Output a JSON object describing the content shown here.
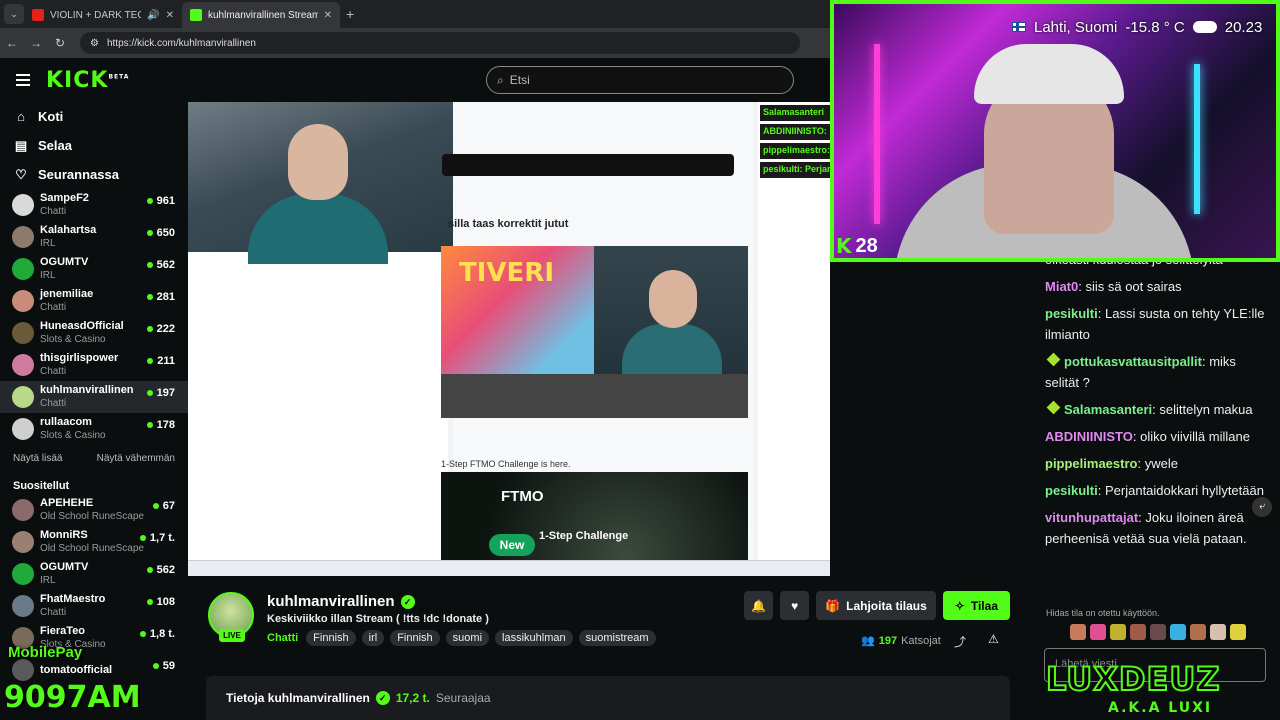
{
  "browser": {
    "tabs": [
      {
        "title": "VIOLIN + DARK TECHNO /",
        "active": false
      },
      {
        "title": "kuhlmanvirallinen Stream - Wa",
        "active": true
      }
    ],
    "url": "https://kick.com/kuhlmanvirallinen"
  },
  "header": {
    "logo": "KICK",
    "logo_badge": "BETA",
    "search_placeholder": "Etsi"
  },
  "nav": [
    {
      "label": "Koti",
      "icon": "home-icon"
    },
    {
      "label": "Selaa",
      "icon": "browse-icon"
    },
    {
      "label": "Seurannassa",
      "icon": "heart-icon"
    }
  ],
  "followed": [
    {
      "name": "SampeF2",
      "category": "Chatti",
      "viewers": "961",
      "color": "#d9d9d9"
    },
    {
      "name": "Kalahartsa",
      "category": "IRL",
      "viewers": "650",
      "color": "#8c7b6a"
    },
    {
      "name": "OGUMTV",
      "category": "IRL",
      "viewers": "562",
      "color": "#1faa3a"
    },
    {
      "name": "jenemiliae",
      "category": "Chatti",
      "viewers": "281",
      "color": "#c98c7a"
    },
    {
      "name": "HuneasdOfficial",
      "category": "Slots & Casino",
      "viewers": "222",
      "color": "#6a5a3a"
    },
    {
      "name": "thisgirlispower",
      "category": "Chatti",
      "viewers": "211",
      "color": "#d07aa0"
    },
    {
      "name": "kuhlmanvirallinen",
      "category": "Chatti",
      "viewers": "197",
      "color": "#b8d88a"
    },
    {
      "name": "rullaacom",
      "category": "Slots & Casino",
      "viewers": "178",
      "color": "#cfcfcf"
    }
  ],
  "show_more": "Näytä lisää",
  "show_less": "Näytä vähemmän",
  "recommended_title": "Suositellut",
  "recommended": [
    {
      "name": "APEHEHE",
      "category": "Old School RuneScape",
      "viewers": "67",
      "color": "#8a6a6a"
    },
    {
      "name": "MonniRS",
      "category": "Old School RuneScape",
      "viewers": "1,7 t.",
      "color": "#9a8070"
    },
    {
      "name": "OGUMTV",
      "category": "IRL",
      "viewers": "562",
      "color": "#1faa3a"
    },
    {
      "name": "FhatMaestro",
      "category": "Chatti",
      "viewers": "108",
      "color": "#6a7a8a"
    },
    {
      "name": "FieraTeo",
      "category": "Slots & Casino",
      "viewers": "1,8 t.",
      "color": "#7a6a5a"
    },
    {
      "name": "tomatoofficial",
      "category": "",
      "viewers": "59",
      "color": "#5a5a5a"
    }
  ],
  "player": {
    "inner_title": "silla taas korrektit jutut",
    "inner_thumb_text": "TIVERI",
    "ad_brand": "FTMO",
    "ad_badge": "New",
    "ad_text": "1-Step Challenge",
    "ad_caption": "1-Step FTMO Challenge is here.",
    "inner_chat": [
      "Salamasanteri",
      "ABDINIINISTO:",
      "pippelimaestro:",
      "pesikulti: Perjan"
    ]
  },
  "channel": {
    "name": "kuhlmanvirallinen",
    "live_label": "LIVE",
    "title": "Keskiviikko illan Stream ( !tts !dc !donate )",
    "category": "Chatti",
    "tags": [
      "Finnish",
      "irl",
      "Finnish",
      "suomi",
      "lassikuhlman",
      "suomistream"
    ],
    "subscribe_label": "Lahjoita tilaus",
    "follow_label": "Tilaa",
    "viewers": "197",
    "viewers_label": "Katsojat",
    "about_label": "Tietoja kuhlmanvirallinen",
    "followers": "17,2 t.",
    "followers_label": "Seuraajaa"
  },
  "chat": {
    "messages": [
      {
        "user": "",
        "color": "#eee",
        "text": "oikeasti kuulostaa jo selittelyltä",
        "emote": false
      },
      {
        "user": "Miat0",
        "color": "#e08af0",
        "text": "siis sä oot sairas",
        "emote": false
      },
      {
        "user": "pesikulti",
        "color": "#7bf08a",
        "text": "Lassi susta on tehty YLE:lle ilmianto",
        "emote": false
      },
      {
        "user": "pottukasvattausitpallit",
        "color": "#7bf08a",
        "text": "miks selität ?",
        "emote": true
      },
      {
        "user": "Salamasanteri",
        "color": "#7bf08a",
        "text": "selittelyn makua",
        "emote": true
      },
      {
        "user": "ABDINIINISTO",
        "color": "#e08af0",
        "text": "oliko viivillä millane",
        "emote": false
      },
      {
        "user": "pippelimaestro",
        "color": "#a6f07a",
        "text": "ywele",
        "emote": false
      },
      {
        "user": "pesikulti",
        "color": "#7bf08a",
        "text": "Perjantaidokkari hyllytetään",
        "emote": false
      },
      {
        "user": "vitunhupattajat",
        "color": "#e08af0",
        "text": "Joku iloinen äreä perheenisä vetää sua vielä pataan.",
        "emote": false
      }
    ],
    "slow_mode": "Hidas tila on otettu käyttöön.",
    "input_placeholder": "Lähetä viesti..."
  },
  "overlay": {
    "location": "Lahti, Suomi",
    "temperature": "-15.8 ° C",
    "time": "20.23",
    "kick_count": "28",
    "brand_big": "LUXDEUZ",
    "brand_small": "A.K.A LUXI",
    "mobilepay": "MobilePay",
    "mobilepay_number": "9097AM"
  }
}
